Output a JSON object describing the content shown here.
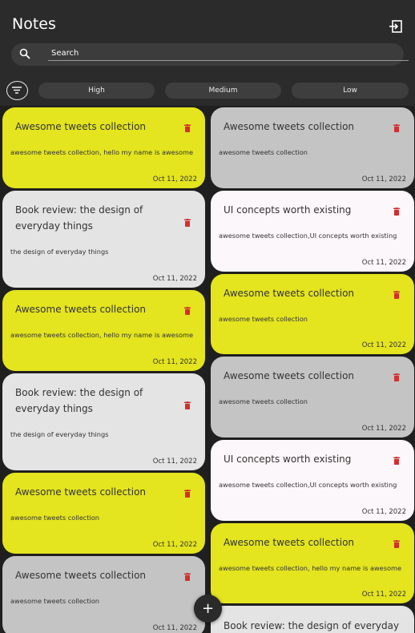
{
  "app": {
    "title": "Notes"
  },
  "search": {
    "placeholder": "Search"
  },
  "filters": {
    "chips": [
      "High",
      "Medium",
      "Low"
    ]
  },
  "colors": {
    "high": "#e4e41f",
    "medium": "#c4c4c4",
    "low_gray": "#e4e4e4",
    "low_white": "#fcf7fa",
    "trash": "#d32f2f"
  },
  "icons": {
    "logout": "logout-icon",
    "search": "search-icon",
    "filter": "filter-icon",
    "delete": "trash-icon",
    "add": "plus-icon"
  },
  "notes": [
    {
      "title": "Awesome tweets collection",
      "body": "awesome tweets collection, hello my name is awesome",
      "date": "Oct 11, 2022",
      "color": "high"
    },
    {
      "title": "Book review: the design of everyday things",
      "body": "the design of everyday things",
      "date": "Oct 11, 2022",
      "color": "low_gray"
    },
    {
      "title": "Awesome tweets collection",
      "body": "awesome tweets collection, hello my name is awesome",
      "date": "Oct 11, 2022",
      "color": "high"
    },
    {
      "title": "Book review: the design of everyday things",
      "body": "the design of everyday things",
      "date": "Oct 11, 2022",
      "color": "low_gray"
    },
    {
      "title": "Awesome tweets collection",
      "body": "awesome tweets collection",
      "date": "Oct 11, 2022",
      "color": "high"
    },
    {
      "title": "Awesome tweets collection",
      "body": "awesome tweets collection",
      "date": "Oct 11, 2022",
      "color": "medium"
    },
    {
      "title": "Awesome tweets collection",
      "body": "awesome tweets collection",
      "date": "Oct 11, 2022",
      "color": "medium"
    },
    {
      "title": "UI concepts worth existing",
      "body": "awesome tweets collection,UI concepts worth existing",
      "date": "Oct 11, 2022",
      "color": "low_white"
    },
    {
      "title": "Awesome tweets collection",
      "body": "awesome tweets collection",
      "date": "Oct 11, 2022",
      "color": "high"
    },
    {
      "title": "Awesome tweets collection",
      "body": "awesome tweets collection",
      "date": "Oct 11, 2022",
      "color": "medium"
    },
    {
      "title": "UI concepts worth existing",
      "body": "awesome tweets collection,UI concepts worth existing",
      "date": "Oct 11, 2022",
      "color": "low_white"
    },
    {
      "title": "Awesome tweets collection",
      "body": "awesome tweets collection, hello my name is awesome",
      "date": "Oct 11, 2022",
      "color": "high"
    },
    {
      "title": "Book review: the design of everyday",
      "body": "",
      "date": "",
      "color": "low_gray"
    }
  ],
  "fab": {
    "label": "+"
  }
}
